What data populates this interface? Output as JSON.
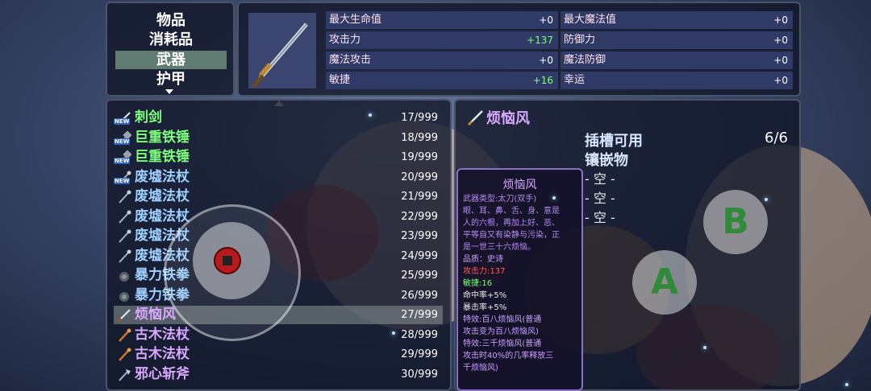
{
  "categories": [
    {
      "label": "物品",
      "selected": false
    },
    {
      "label": "消耗品",
      "selected": false
    },
    {
      "label": "武器",
      "selected": true
    },
    {
      "label": "护甲",
      "selected": false
    }
  ],
  "stats": {
    "left": [
      {
        "label": "最大生命值",
        "value": "+0"
      },
      {
        "label": "攻击力",
        "value": "+137"
      },
      {
        "label": "魔法攻击",
        "value": "+0"
      },
      {
        "label": "敏捷",
        "value": "+16"
      }
    ],
    "right": [
      {
        "label": "最大魔法值",
        "value": "+0"
      },
      {
        "label": "防御力",
        "value": "+0"
      },
      {
        "label": "魔法防御",
        "value": "+0"
      },
      {
        "label": "幸运",
        "value": "+0"
      }
    ]
  },
  "items": [
    {
      "name": "刺剑",
      "count": "17/999",
      "new": true,
      "color": "green",
      "icon": "sword-icon"
    },
    {
      "name": "巨重铁锤",
      "count": "18/999",
      "new": true,
      "color": "green",
      "icon": "hammer-icon"
    },
    {
      "name": "巨重铁锤",
      "count": "19/999",
      "new": true,
      "color": "green",
      "icon": "hammer-icon"
    },
    {
      "name": "废墟法杖",
      "count": "20/999",
      "new": true,
      "color": "blue",
      "icon": "staff-icon"
    },
    {
      "name": "废墟法杖",
      "count": "21/999",
      "new": false,
      "color": "blue",
      "icon": "staff-icon"
    },
    {
      "name": "废墟法杖",
      "count": "22/999",
      "new": false,
      "color": "blue",
      "icon": "staff-icon"
    },
    {
      "name": "废墟法杖",
      "count": "23/999",
      "new": false,
      "color": "blue",
      "icon": "staff-icon"
    },
    {
      "name": "废墟法杖",
      "count": "24/999",
      "new": false,
      "color": "blue",
      "icon": "staff-icon"
    },
    {
      "name": "暴力铁拳",
      "count": "25/999",
      "new": false,
      "color": "blue",
      "icon": "fist-icon"
    },
    {
      "name": "暴力铁拳",
      "count": "26/999",
      "new": false,
      "color": "blue",
      "icon": "fist-icon"
    },
    {
      "name": "烦恼风",
      "count": "27/999",
      "new": false,
      "color": "purple",
      "icon": "sword-icon",
      "selected": true
    },
    {
      "name": "古木法杖",
      "count": "28/999",
      "new": false,
      "color": "purple",
      "icon": "wood-staff-icon"
    },
    {
      "name": "古木法杖",
      "count": "29/999",
      "new": false,
      "color": "purple",
      "icon": "wood-staff-icon"
    },
    {
      "name": "邪心斩斧",
      "count": "30/999",
      "new": false,
      "color": "purple",
      "icon": "axe-icon"
    }
  ],
  "new_tag": "NEW",
  "detail": {
    "title": "烦恼风",
    "slots_label": "插槽可用",
    "inlay_label": "镶嵌物",
    "slot_count": "6/6",
    "empty_slots": [
      "- 空 -",
      "- 空 -",
      "- 空 -"
    ]
  },
  "tooltip": {
    "title": "烦恼风",
    "lines": [
      {
        "text": "武器类型:太刀(双手)",
        "style": "desc"
      },
      {
        "text": "眼、耳、鼻、舌、身、意是",
        "style": "desc"
      },
      {
        "text": "人的六根，再加上好、恶、",
        "style": "desc"
      },
      {
        "text": "平等自又有染静与污染，正",
        "style": "desc"
      },
      {
        "text": "是一世三十六烦恼。",
        "style": "desc"
      },
      {
        "text": "品质：史诗",
        "style": "quality"
      },
      {
        "text": "攻击力:137",
        "style": "red"
      },
      {
        "text": "敏捷:16",
        "style": "green"
      },
      {
        "text": "命中率+5%",
        "style": "white"
      },
      {
        "text": "暴击率+5%",
        "style": "white"
      },
      {
        "text": "特效:百八烦恼风(普通",
        "style": "effect"
      },
      {
        "text": "攻击变为百八烦恼风)",
        "style": "effect"
      },
      {
        "text": "特效:三千烦恼风(普通",
        "style": "effect"
      },
      {
        "text": "攻击时40%的几率释放三",
        "style": "effect"
      },
      {
        "text": "千烦恼风)",
        "style": "effect"
      }
    ]
  },
  "controls": {
    "a_label": "A",
    "b_label": "B"
  },
  "colors": {
    "accent_green": "#7dff7d",
    "epic_purple": "#d9a8ff",
    "rare_blue": "#9fd0ff",
    "selected_row": "#5f7b72"
  }
}
